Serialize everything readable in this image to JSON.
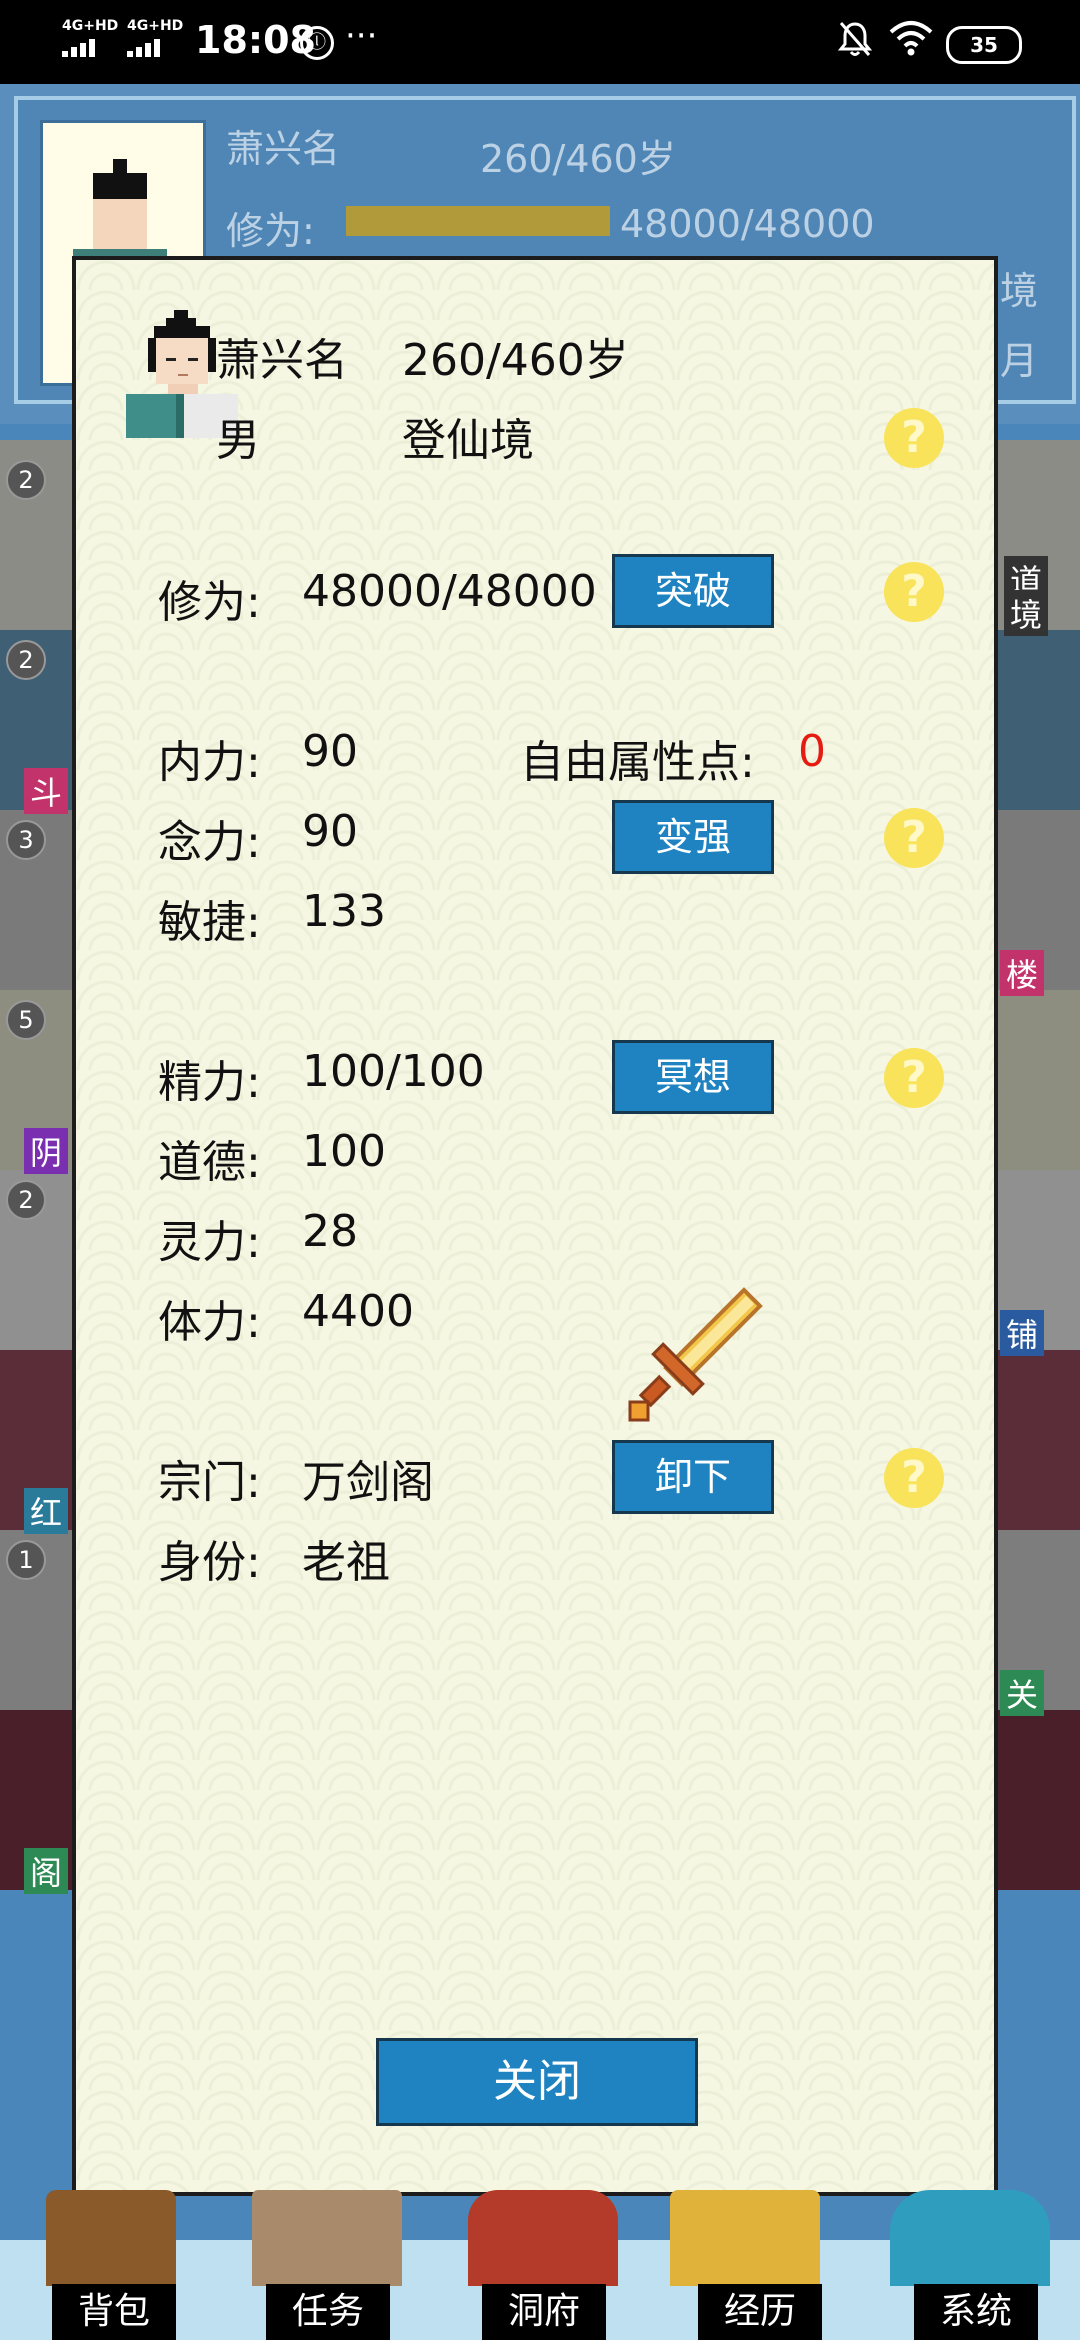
{
  "status_bar": {
    "signal1": "4G+HD",
    "signal2": "4G+HD",
    "time": "18:08",
    "notification_glyph": "ⓛ",
    "more": "···",
    "battery": "35"
  },
  "background": {
    "name": "萧兴名",
    "age": "260/460岁",
    "xiuwei_label": "修为:",
    "xiuwei_value": "48000/48000",
    "side_text_1": "境",
    "side_text_2": "月",
    "side_tag_1": "斗",
    "side_tag_2": "阴",
    "side_tag_3": "红",
    "side_tag_4": "阁",
    "right_tag_1": "楼",
    "right_tag_2": "铺",
    "right_tag_3": "关",
    "right_sign_top": "道",
    "right_sign_bottom": "境",
    "badges": [
      "2",
      "2",
      "3",
      "5",
      "2",
      "1"
    ]
  },
  "dialog": {
    "name": "萧兴名",
    "age": "260/460岁",
    "gender": "男",
    "realm": "登仙境",
    "cultivation_label": "修为:",
    "cultivation_value": "48000/48000",
    "breakthrough_button": "突破",
    "neili_label": "内力:",
    "neili_value": "90",
    "free_points_label": "自由属性点:",
    "free_points_value": "0",
    "nianli_label": "念力:",
    "nianli_value": "90",
    "strengthen_button": "变强",
    "minjie_label": "敏捷:",
    "minjie_value": "133",
    "jingli_label": "精力:",
    "jingli_value": "100/100",
    "meditate_button": "冥想",
    "daode_label": "道德:",
    "daode_value": "100",
    "lingli_label": "灵力:",
    "lingli_value": "28",
    "tili_label": "体力:",
    "tili_value": "4400",
    "sect_label": "宗门:",
    "sect_value": "万剑阁",
    "unequip_button": "卸下",
    "identity_label": "身份:",
    "identity_value": "老祖",
    "help_glyph": "?",
    "close_button": "关闭"
  },
  "bottom_nav": {
    "items": [
      "背包",
      "任务",
      "洞府",
      "经历",
      "系统"
    ]
  },
  "colors": {
    "dialog_bg": "#f6f7e3",
    "button_blue": "#1f83c1",
    "help_yellow": "#f9e35a",
    "highlight_red": "#e51c12",
    "nav_bg": "#bfe0f1"
  }
}
